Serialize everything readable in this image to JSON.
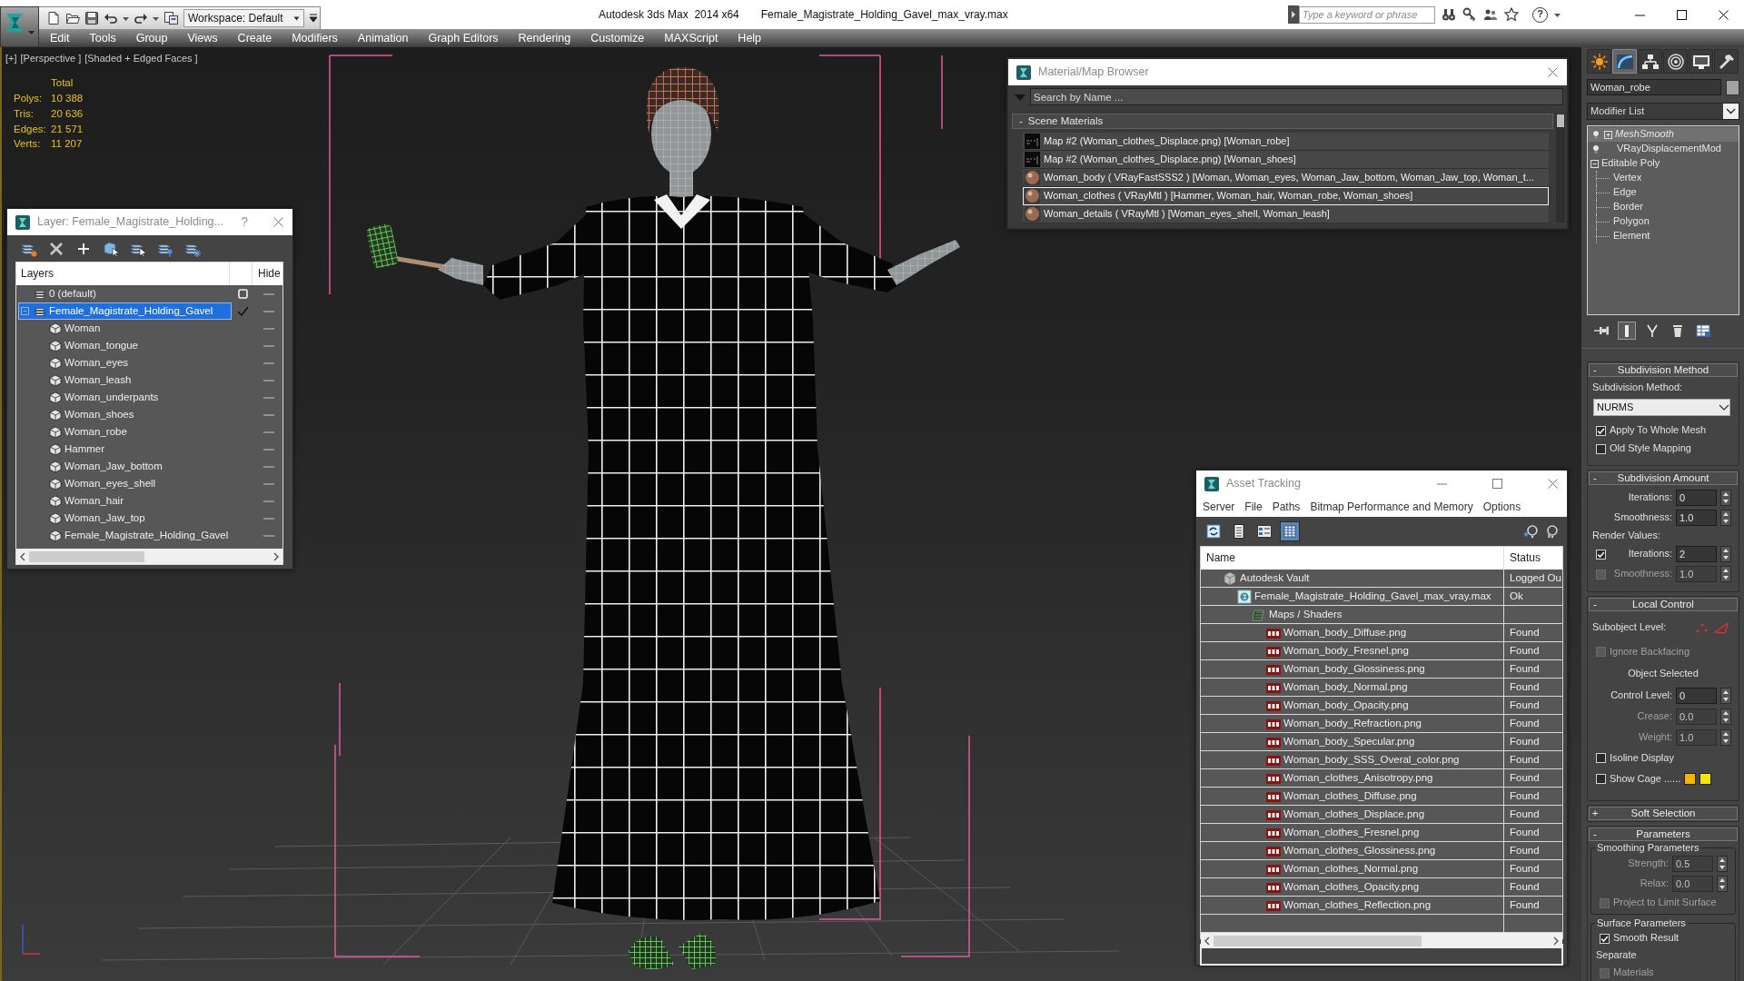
{
  "title_bar": {
    "workspace": "Workspace: Default",
    "app_title": "Autodesk 3ds Max  2014 x64",
    "file_title": "Female_Magistrate_Holding_Gavel_max_vray.max",
    "search": {
      "placeholder": "Type a keyword or phrase"
    },
    "help": "?"
  },
  "menu_bar": [
    "Edit",
    "Tools",
    "Group",
    "Views",
    "Create",
    "Modifiers",
    "Animation",
    "Graph Editors",
    "Rendering",
    "Customize",
    "MAXScript",
    "Help"
  ],
  "viewport": {
    "labels": [
      "[+]",
      "[Perspective ]",
      "[Shaded + Edged Faces ]"
    ],
    "stats": {
      "header": "Total",
      "rows": [
        {
          "label": "Polys:",
          "value": "10 388"
        },
        {
          "label": "Tris:",
          "value": "20 636"
        },
        {
          "label": "Edges:",
          "value": "21 571"
        },
        {
          "label": "Verts:",
          "value": "11 207"
        }
      ]
    }
  },
  "layer_dialog": {
    "title": "Layer: Female_Magistrate_Holding...",
    "help": "?",
    "columns": [
      "Layers",
      "Hide"
    ],
    "layers": [
      {
        "kind": "layer",
        "name": "0 (default)",
        "selected": false,
        "current": false,
        "hidden": false
      },
      {
        "kind": "layer",
        "name": "Female_Magistrate_Holding_Gavel",
        "selected": true,
        "current": true,
        "hidden": false,
        "expanded": true,
        "children": [
          {
            "kind": "object",
            "name": "Woman",
            "selected": false,
            "hidden": false
          },
          {
            "kind": "object",
            "name": "Woman_tongue",
            "selected": false,
            "hidden": false
          },
          {
            "kind": "object",
            "name": "Woman_eyes",
            "selected": false,
            "hidden": false
          },
          {
            "kind": "object",
            "name": "Woman_leash",
            "selected": false,
            "hidden": false
          },
          {
            "kind": "object",
            "name": "Woman_underpants",
            "selected": false,
            "hidden": false
          },
          {
            "kind": "object",
            "name": "Woman_shoes",
            "selected": false,
            "hidden": false
          },
          {
            "kind": "object",
            "name": "Woman_robe",
            "selected": false,
            "hidden": false
          },
          {
            "kind": "object",
            "name": "Hammer",
            "selected": false,
            "hidden": false
          },
          {
            "kind": "object",
            "name": "Woman_Jaw_bottom",
            "selected": false,
            "hidden": false
          },
          {
            "kind": "object",
            "name": "Woman_eyes_shell",
            "selected": false,
            "hidden": false
          },
          {
            "kind": "object",
            "name": "Woman_hair",
            "selected": false,
            "hidden": false
          },
          {
            "kind": "object",
            "name": "Woman_Jaw_top",
            "selected": false,
            "hidden": false
          },
          {
            "kind": "object",
            "name": "Female_Magistrate_Holding_Gavel",
            "selected": false,
            "hidden": false
          }
        ]
      }
    ]
  },
  "material_browser": {
    "title": "Material/Map Browser",
    "search": {
      "placeholder": "Search by Name ..."
    },
    "groups": [
      {
        "sign": "-",
        "label": "Scene Materials",
        "items": [
          {
            "kind": "map",
            "text": "Map #2 (Woman_clothes_Displace.png) [Woman_robe]",
            "selected": false
          },
          {
            "kind": "map",
            "text": "Map #2 (Woman_clothes_Displace.png) [Woman_shoes]",
            "selected": false
          },
          {
            "kind": "material",
            "text": "Woman_body ( VRayFastSSS2 ) [Woman, Woman_eyes, Woman_Jaw_bottom, Woman_Jaw_top, Woman_t...",
            "selected": false
          },
          {
            "kind": "material",
            "text": "Woman_clothes ( VRayMtl ) [Hammer, Woman_hair, Woman_robe, Woman_shoes]",
            "selected": true
          },
          {
            "kind": "material",
            "text": "Woman_details ( VRayMtl ) [Woman_eyes_shell, Woman_leash]",
            "selected": false
          }
        ]
      }
    ]
  },
  "asset_tracking": {
    "title": "Asset Tracking",
    "menu": [
      "Server",
      "File",
      "Paths",
      "Bitmap Performance and Memory",
      "Options"
    ],
    "toolbar": [
      {
        "kind": "refresh",
        "selected": false
      },
      {
        "kind": "list",
        "selected": false
      },
      {
        "kind": "thumbnails",
        "selected": false
      },
      {
        "kind": "table",
        "selected": true
      }
    ],
    "columns": [
      "Name",
      "Status"
    ],
    "tree": [
      {
        "kind": "vault",
        "name": "Autodesk Vault",
        "status": "Logged Ou",
        "selected": false,
        "children": [
          {
            "kind": "scene",
            "name": "Female_Magistrate_Holding_Gavel_max_vray.max",
            "status": "Ok",
            "selected": false,
            "children": [
              {
                "kind": "folder",
                "name": "Maps / Shaders",
                "selected": false,
                "children": [
                  {
                    "kind": "png",
                    "name": "Woman_body_Diffuse.png",
                    "status": "Found",
                    "selected": false
                  },
                  {
                    "kind": "png",
                    "name": "Woman_body_Fresnel.png",
                    "status": "Found",
                    "selected": false
                  },
                  {
                    "kind": "png",
                    "name": "Woman_body_Glossiness.png",
                    "status": "Found",
                    "selected": false
                  },
                  {
                    "kind": "png",
                    "name": "Woman_body_Normal.png",
                    "status": "Found",
                    "selected": false
                  },
                  {
                    "kind": "png",
                    "name": "Woman_body_Opacity.png",
                    "status": "Found",
                    "selected": false
                  },
                  {
                    "kind": "png",
                    "name": "Woman_body_Refraction.png",
                    "status": "Found",
                    "selected": false
                  },
                  {
                    "kind": "png",
                    "name": "Woman_body_Specular.png",
                    "status": "Found",
                    "selected": false
                  },
                  {
                    "kind": "png",
                    "name": "Woman_body_SSS_Overal_color.png",
                    "status": "Found",
                    "selected": false
                  },
                  {
                    "kind": "png",
                    "name": "Woman_clothes_Anisotropy.png",
                    "status": "Found",
                    "selected": false
                  },
                  {
                    "kind": "png",
                    "name": "Woman_clothes_Diffuse.png",
                    "status": "Found",
                    "selected": false
                  },
                  {
                    "kind": "png",
                    "name": "Woman_clothes_Displace.png",
                    "status": "Found",
                    "selected": false
                  },
                  {
                    "kind": "png",
                    "name": "Woman_clothes_Fresnel.png",
                    "status": "Found",
                    "selected": false
                  },
                  {
                    "kind": "png",
                    "name": "Woman_clothes_Glossiness.png",
                    "status": "Found",
                    "selected": false
                  },
                  {
                    "kind": "png",
                    "name": "Woman_clothes_Normal.png",
                    "status": "Found",
                    "selected": false
                  },
                  {
                    "kind": "png",
                    "name": "Woman_clothes_Opacity.png",
                    "status": "Found",
                    "selected": false
                  },
                  {
                    "kind": "png",
                    "name": "Woman_clothes_Reflection.png",
                    "status": "Found",
                    "selected": false
                  }
                ]
              }
            ]
          }
        ]
      }
    ]
  },
  "command_panel": {
    "tabs": [
      {
        "kind": "create",
        "selected": false
      },
      {
        "kind": "modify",
        "selected": true
      },
      {
        "kind": "hierarchy",
        "selected": false
      },
      {
        "kind": "motion",
        "selected": false
      },
      {
        "kind": "display",
        "selected": false
      },
      {
        "kind": "utilities",
        "selected": false
      }
    ],
    "object_name": "Woman_robe",
    "modifier_list": "Modifier List",
    "stack": [
      {
        "kind": "modifier",
        "name": "MeshSmooth",
        "selected": true,
        "expanded": false
      },
      {
        "kind": "modifier",
        "name": "VRayDisplacementMod",
        "selected": false
      },
      {
        "kind": "base",
        "name": "Editable Poly",
        "selected": false,
        "expanded": true,
        "children": [
          {
            "name": "Vertex",
            "selected": false
          },
          {
            "name": "Edge",
            "selected": false
          },
          {
            "name": "Border",
            "selected": false
          },
          {
            "name": "Polygon",
            "selected": false
          },
          {
            "name": "Element",
            "selected": false
          }
        ]
      }
    ],
    "stack_tools": [
      {
        "kind": "pin",
        "on": false
      },
      {
        "kind": "end_result",
        "on": true
      },
      {
        "kind": "unique",
        "on": false
      },
      {
        "kind": "remove",
        "on": false
      },
      {
        "kind": "configure",
        "on": false
      }
    ],
    "rollouts": [
      {
        "sign": "-",
        "title": "Subdivision Method",
        "controls": [
          {
            "kind": "label",
            "text": "Subdivision Method:"
          },
          {
            "kind": "dropdown",
            "value": "NURMS"
          },
          {
            "kind": "checkbox",
            "label": "Apply To Whole Mesh",
            "checked": true,
            "disabled": false
          },
          {
            "kind": "checkbox",
            "label": "Old Style Mapping",
            "checked": false,
            "disabled": false
          }
        ]
      },
      {
        "sign": "-",
        "title": "Subdivision Amount",
        "controls": [
          {
            "kind": "spinner",
            "label": "Iterations:",
            "value": "0",
            "disabled": false
          },
          {
            "kind": "spinner",
            "label": "Smoothness:",
            "value": "1.0",
            "disabled": false
          },
          {
            "kind": "label",
            "text": "Render Values:"
          },
          {
            "kind": "checkspinner",
            "label": "Iterations:",
            "value": "2",
            "checked": true,
            "disabled": false
          },
          {
            "kind": "checkspinner",
            "label": "Smoothness:",
            "value": "1.0",
            "checked": false,
            "disabled": true
          }
        ]
      },
      {
        "sign": "-",
        "title": "Local Control",
        "controls": [
          {
            "kind": "subobject",
            "label": "Subobject Level:"
          },
          {
            "kind": "checkbox",
            "label": "Ignore Backfacing",
            "checked": false,
            "disabled": true
          },
          {
            "kind": "center",
            "text": "Object Selected"
          },
          {
            "kind": "spinner",
            "label": "Control Level:",
            "value": "0",
            "disabled": false
          },
          {
            "kind": "spinner",
            "label": "Crease:",
            "value": "0.0",
            "disabled": true
          },
          {
            "kind": "spinner",
            "label": "Weight:",
            "value": "1.0",
            "disabled": true
          },
          {
            "kind": "checkbox",
            "label": "Isoline Display",
            "checked": false,
            "disabled": false
          },
          {
            "kind": "cage",
            "label": "Show Cage ......",
            "checked": false,
            "disabled": false,
            "swatches": [
              {
                "color": "#f5b400"
              },
              {
                "color": "#f5e600"
              }
            ]
          }
        ]
      },
      {
        "sign": "+",
        "title": "Soft Selection"
      },
      {
        "sign": "-",
        "title": "Parameters",
        "groups": [
          {
            "title": "Smoothing Parameters",
            "controls": [
              {
                "kind": "spinner",
                "label": "Strength:",
                "value": "0.5",
                "disabled": true
              },
              {
                "kind": "spinner",
                "label": "Relax:",
                "value": "0.0",
                "disabled": true
              },
              {
                "kind": "checkbox",
                "label": "Project to Limit Surface",
                "checked": false,
                "disabled": true
              }
            ]
          },
          {
            "title": "Surface Parameters",
            "controls": [
              {
                "kind": "checkbox",
                "label": "Smooth Result",
                "checked": true,
                "disabled": false
              },
              {
                "kind": "label",
                "text": "Separate"
              },
              {
                "kind": "checkbox",
                "label": "Materials",
                "checked": false,
                "disabled": true
              }
            ]
          }
        ]
      }
    ]
  }
}
